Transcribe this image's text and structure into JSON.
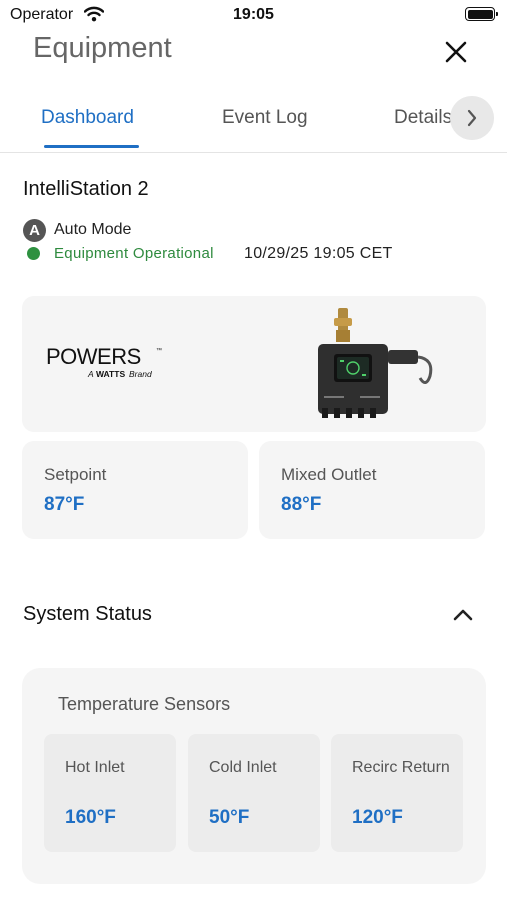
{
  "status_bar": {
    "carrier": "Operator",
    "time": "19:05"
  },
  "header": {
    "title": "Equipment"
  },
  "tabs": [
    {
      "label": "Dashboard",
      "active": true
    },
    {
      "label": "Event Log",
      "active": false
    },
    {
      "label": "Details",
      "active": false
    }
  ],
  "station": {
    "name": "IntelliStation 2",
    "mode_badge": "A",
    "mode_label": "Auto Mode",
    "operational_label": "Equipment Operational",
    "timestamp": "10/29/25 19:05 CET"
  },
  "brand": {
    "name": "POWERS",
    "tagline_prefix": "A",
    "tagline_brand": "WATTS",
    "tagline_suffix": "Brand"
  },
  "metrics": [
    {
      "label": "Setpoint",
      "value": "87°F"
    },
    {
      "label": "Mixed Outlet",
      "value": "88°F"
    }
  ],
  "system_status": {
    "title": "System Status",
    "sensors_title": "Temperature Sensors",
    "sensors": [
      {
        "label": "Hot Inlet",
        "value": "160°F"
      },
      {
        "label": "Cold Inlet",
        "value": "50°F"
      },
      {
        "label": "Recirc Return",
        "value": "120°F"
      }
    ]
  },
  "colors": {
    "accent": "#1f6fc4",
    "operational": "#2e9140",
    "card_bg": "#f5f5f5"
  },
  "icons": [
    "wifi-icon",
    "battery-icon",
    "close-icon",
    "chevron-right-icon",
    "chevron-up-icon",
    "auto-mode-badge",
    "status-dot"
  ]
}
